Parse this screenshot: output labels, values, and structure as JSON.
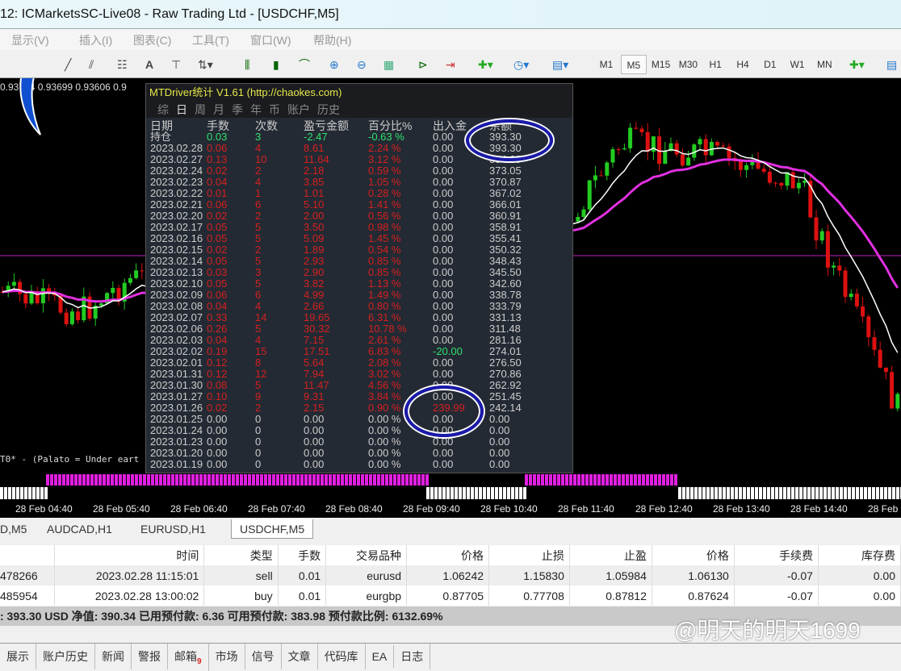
{
  "window": {
    "title": "12: ICMarketsSC-Live08 - Raw Trading Ltd - [USDCHF,M5]"
  },
  "menu": [
    "显示(V)",
    "插入(I)",
    "图表(C)",
    "工具(T)",
    "窗口(W)",
    "帮助(H)"
  ],
  "timeframes": [
    "M1",
    "M5",
    "M15",
    "M30",
    "H1",
    "H4",
    "D1",
    "W1",
    "MN"
  ],
  "active_timeframe": "M5",
  "chart": {
    "ohlc": "0.93714 0.93699 0.93606 0.9",
    "indicator_label": "T0* - (Palato = Under eart",
    "time_labels": [
      "28 Feb 04:40",
      "28 Feb 05:40",
      "28 Feb 06:40",
      "28 Feb 07:40",
      "28 Feb 08:40",
      "28 Feb 09:40",
      "28 Feb 10:40",
      "28 Feb 11:40",
      "28 Feb 12:40",
      "28 Feb 13:40",
      "28 Feb 14:40",
      "28 Feb"
    ]
  },
  "panel": {
    "title": "MTDriver统计 V1.61  (http://chaokes.com)",
    "tabs": [
      "综",
      "日",
      "周",
      "月",
      "季",
      "年",
      "币",
      "账户",
      "历史"
    ],
    "headers": [
      "日期",
      "手数",
      "次数",
      "盈亏金额",
      "百分比%",
      "出入金",
      "余额"
    ],
    "holding": [
      "持仓",
      "0.03",
      "3",
      "-2.47",
      "-0.63 %",
      "0.00",
      "393.30"
    ],
    "rows": [
      [
        "2023.02.28",
        "0.06",
        "4",
        "8.61",
        "2.24 %",
        "0.00",
        "393.30"
      ],
      [
        "2023.02.27",
        "0.13",
        "10",
        "11.64",
        "3.12 %",
        "0.00",
        "384.69"
      ],
      [
        "2023.02.24",
        "0.02",
        "2",
        "2.18",
        "0.59 %",
        "0.00",
        "373.05"
      ],
      [
        "2023.02.23",
        "0.04",
        "4",
        "3.85",
        "1.05 %",
        "0.00",
        "370.87"
      ],
      [
        "2023.02.22",
        "0.01",
        "1",
        "1.01",
        "0.28 %",
        "0.00",
        "367.02"
      ],
      [
        "2023.02.21",
        "0.06",
        "6",
        "5.10",
        "1.41 %",
        "0.00",
        "366.01"
      ],
      [
        "2023.02.20",
        "0.02",
        "2",
        "2.00",
        "0.56 %",
        "0.00",
        "360.91"
      ],
      [
        "2023.02.17",
        "0.05",
        "5",
        "3.50",
        "0.98 %",
        "0.00",
        "358.91"
      ],
      [
        "2023.02.16",
        "0.05",
        "5",
        "5.09",
        "1.45 %",
        "0.00",
        "355.41"
      ],
      [
        "2023.02.15",
        "0.02",
        "2",
        "1.89",
        "0.54 %",
        "0.00",
        "350.32"
      ],
      [
        "2023.02.14",
        "0.05",
        "5",
        "2.93",
        "0.85 %",
        "0.00",
        "348.43"
      ],
      [
        "2023.02.13",
        "0.03",
        "3",
        "2.90",
        "0.85 %",
        "0.00",
        "345.50"
      ],
      [
        "2023.02.10",
        "0.05",
        "5",
        "3.82",
        "1.13 %",
        "0.00",
        "342.60"
      ],
      [
        "2023.02.09",
        "0.06",
        "6",
        "4.99",
        "1.49 %",
        "0.00",
        "338.78"
      ],
      [
        "2023.02.08",
        "0.04",
        "4",
        "2.66",
        "0.80 %",
        "0.00",
        "333.79"
      ],
      [
        "2023.02.07",
        "0.33",
        "14",
        "19.65",
        "6.31 %",
        "0.00",
        "331.13"
      ],
      [
        "2023.02.06",
        "0.26",
        "5",
        "30.32",
        "10.78 %",
        "0.00",
        "311.48"
      ],
      [
        "2023.02.03",
        "0.04",
        "4",
        "7.15",
        "2.61 %",
        "0.00",
        "281.16"
      ],
      [
        "2023.02.02",
        "0.19",
        "15",
        "17.51",
        "6.83 %",
        "-20.00",
        "274.01"
      ],
      [
        "2023.02.01",
        "0.12",
        "8",
        "5.64",
        "2.08 %",
        "0.00",
        "276.50"
      ],
      [
        "2023.01.31",
        "0.12",
        "12",
        "7.94",
        "3.02 %",
        "0.00",
        "270.86"
      ],
      [
        "2023.01.30",
        "0.08",
        "5",
        "11.47",
        "4.56 %",
        "0.00",
        "262.92"
      ],
      [
        "2023.01.27",
        "0.10",
        "9",
        "9.31",
        "3.84 %",
        "0.00",
        "251.45"
      ],
      [
        "2023.01.26",
        "0.02",
        "2",
        "2.15",
        "0.90 %",
        "239.99",
        "242.14"
      ],
      [
        "2023.01.25",
        "0.00",
        "0",
        "0.00",
        "0.00 %",
        "0.00",
        "0.00"
      ],
      [
        "2023.01.24",
        "0.00",
        "0",
        "0.00",
        "0.00 %",
        "0.00",
        "0.00"
      ],
      [
        "2023.01.23",
        "0.00",
        "0",
        "0.00",
        "0.00 %",
        "0.00",
        "0.00"
      ],
      [
        "2023.01.20",
        "0.00",
        "0",
        "0.00",
        "0.00 %",
        "0.00",
        "0.00"
      ],
      [
        "2023.01.19",
        "0.00",
        "0",
        "0.00",
        "0.00 %",
        "0.00",
        "0.00"
      ]
    ]
  },
  "chart_tabs": [
    "D,M5",
    "AUDCAD,H1",
    "EURUSD,H1",
    "USDCHF,M5"
  ],
  "trade": {
    "headers": [
      "",
      "时间",
      "类型",
      "手数",
      "交易品种",
      "价格",
      "止损",
      "止盈",
      "价格",
      "手续费",
      "库存费"
    ],
    "rows": [
      [
        "478266",
        "2023.02.28 11:15:01",
        "sell",
        "0.01",
        "eurusd",
        "1.06242",
        "1.15830",
        "1.05984",
        "1.06130",
        "-0.07",
        "0.00"
      ],
      [
        "485954",
        "2023.02.28 13:00:02",
        "buy",
        "0.01",
        "eurgbp",
        "0.87705",
        "0.77708",
        "0.87812",
        "0.87624",
        "-0.07",
        "0.00"
      ]
    ]
  },
  "account": ": 393.30 USD  净值: 390.34  已用预付款: 6.36  可用预付款: 383.98  预付款比例: 6132.69%",
  "watermark": "@明天的明天1699",
  "bottom_tabs": [
    "展示",
    "账户历史",
    "新闻",
    "警报",
    "邮箱",
    "市场",
    "信号",
    "文章",
    "代码库",
    "EA",
    "日志"
  ],
  "mail_count": "9",
  "colors": {
    "profit": "#d42020",
    "gain": "#2ee070",
    "ma_fast": "#ffffff",
    "ma_slow": "#e030e0",
    "bull": "#22cc22",
    "bear": "#dd1111"
  }
}
